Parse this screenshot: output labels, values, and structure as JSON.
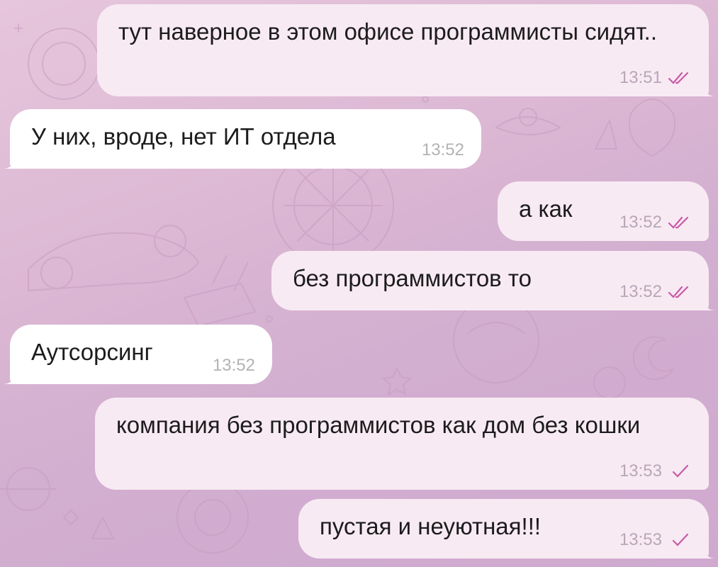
{
  "messages": [
    {
      "direction": "out",
      "text": "тут наверное в этом офисе программисты сидят..",
      "time": "13:51",
      "status_icon": "double-check-icon"
    },
    {
      "direction": "in",
      "text": "У них, вроде, нет ИТ отдела",
      "time": "13:52"
    },
    {
      "direction": "out",
      "text": "а как",
      "time": "13:52",
      "status_icon": "double-check-icon"
    },
    {
      "direction": "out",
      "text": "без программистов то",
      "time": "13:52",
      "status_icon": "double-check-icon"
    },
    {
      "direction": "in",
      "text": "Аутсорсинг",
      "time": "13:52"
    },
    {
      "direction": "out",
      "text": "компания без программистов как дом без кошки",
      "time": "13:53",
      "status_icon": "single-check-icon"
    },
    {
      "direction": "out",
      "text": "пустая и неуютная!!!",
      "time": "13:53",
      "status_icon": "single-check-icon"
    }
  ],
  "colors": {
    "outgoing_bubble": "#f8eaf3",
    "incoming_bubble": "#ffffff",
    "check_mark": "#c85aa8",
    "time_text": "#b9a6b6",
    "background": "#dcb8d4"
  }
}
